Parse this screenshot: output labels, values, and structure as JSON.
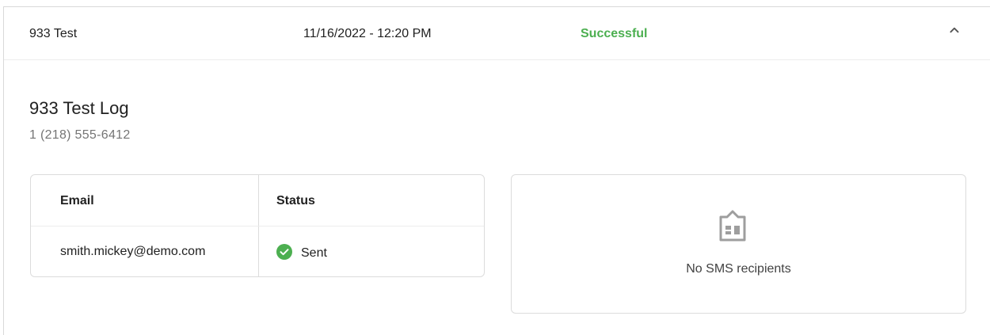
{
  "summary": {
    "name": "933 Test",
    "datetime": "11/16/2022 - 12:20 PM",
    "status": "Successful",
    "status_color": "#4caf50",
    "toggle_icon": "chevron-up-icon"
  },
  "log": {
    "title": "933 Test Log",
    "phone": "1 (218) 555-6412"
  },
  "email_table": {
    "headers": [
      "Email",
      "Status"
    ],
    "rows": [
      {
        "email": "smith.mickey@demo.com",
        "status": "Sent",
        "status_icon": "check-circle-icon",
        "status_color": "#4caf50"
      }
    ]
  },
  "sms": {
    "empty_icon": "building-icon",
    "empty_message": "No SMS recipients"
  }
}
